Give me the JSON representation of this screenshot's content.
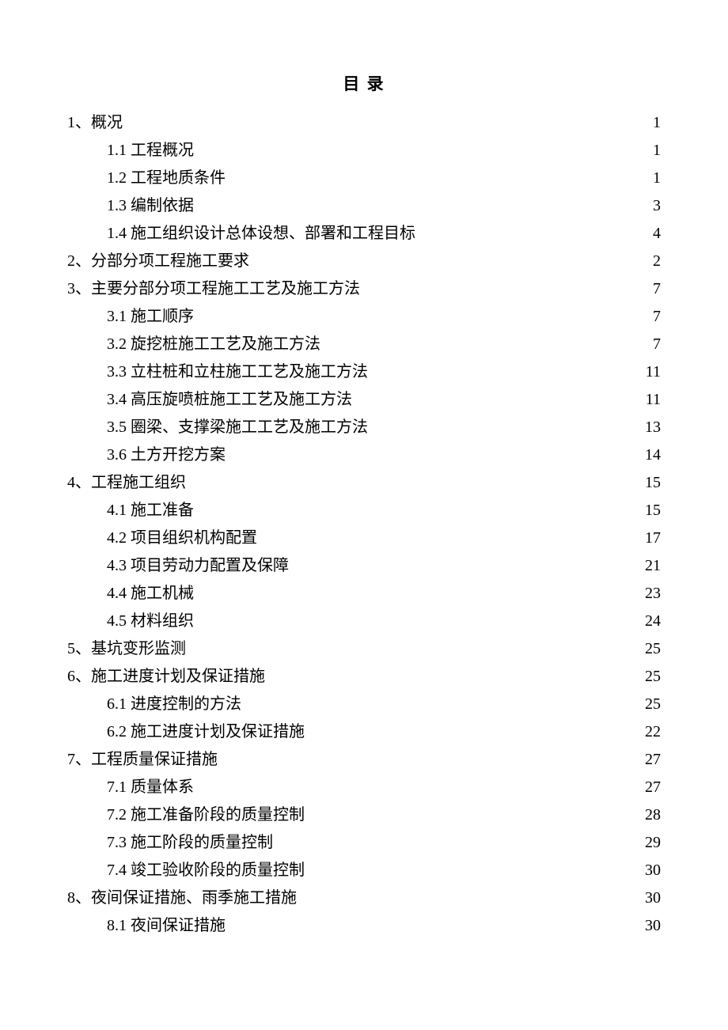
{
  "title": "目 录",
  "toc": [
    {
      "level": 1,
      "label": "1、概况",
      "page": "1"
    },
    {
      "level": 2,
      "label": "1.1 工程概况",
      "page": "1"
    },
    {
      "level": 2,
      "label": "1.2 工程地质条件",
      "page": "1"
    },
    {
      "level": 2,
      "label": "1.3 编制依据",
      "page": "3"
    },
    {
      "level": 2,
      "label": "1.4 施工组织设计总体设想、部署和工程目标",
      "page": "4"
    },
    {
      "level": 1,
      "label": "2、分部分项工程施工要求",
      "page": "2"
    },
    {
      "level": 1,
      "label": "3、主要分部分项工程施工工艺及施工方法",
      "page": "7"
    },
    {
      "level": 2,
      "label": "3.1 施工顺序",
      "page": "7"
    },
    {
      "level": 2,
      "label": "3.2 旋挖桩施工工艺及施工方法",
      "page": "7"
    },
    {
      "level": 2,
      "label": "3.3 立柱桩和立柱施工工艺及施工方法",
      "page": "11"
    },
    {
      "level": 2,
      "label": "3.4 高压旋喷桩施工工艺及施工方法",
      "page": "11"
    },
    {
      "level": 2,
      "label": "3.5 圈梁、支撑梁施工工艺及施工方法",
      "page": "13"
    },
    {
      "level": 2,
      "label": "3.6 土方开挖方案",
      "page": "14"
    },
    {
      "level": 1,
      "label": "4、工程施工组织",
      "page": "15"
    },
    {
      "level": 2,
      "label": "4.1 施工准备",
      "page": "15"
    },
    {
      "level": 2,
      "label": "4.2 项目组织机构配置",
      "page": "17"
    },
    {
      "level": 2,
      "label": "4.3 项目劳动力配置及保障",
      "page": "21"
    },
    {
      "level": 2,
      "label": "4.4 施工机械",
      "page": "23"
    },
    {
      "level": 2,
      "label": "4.5 材料组织",
      "page": "24"
    },
    {
      "level": 1,
      "label": "5、基坑变形监测",
      "page": "25"
    },
    {
      "level": 1,
      "label": "6、施工进度计划及保证措施",
      "page": "25"
    },
    {
      "level": 2,
      "label": "6.1 进度控制的方法",
      "page": "25"
    },
    {
      "level": 2,
      "label": "6.2 施工进度计划及保证措施",
      "page": "22"
    },
    {
      "level": 1,
      "label": "7、工程质量保证措施",
      "page": "27"
    },
    {
      "level": 2,
      "label": "7.1 质量体系",
      "page": "27"
    },
    {
      "level": 2,
      "label": "7.2 施工准备阶段的质量控制",
      "page": "28"
    },
    {
      "level": 2,
      "label": "7.3 施工阶段的质量控制",
      "page": "29"
    },
    {
      "level": 2,
      "label": "7.4 竣工验收阶段的质量控制",
      "page": "30"
    },
    {
      "level": 1,
      "label": "8、夜间保证措施、雨季施工措施",
      "page": "30"
    },
    {
      "level": 2,
      "label": "8.1 夜间保证措施",
      "page": "30"
    }
  ]
}
